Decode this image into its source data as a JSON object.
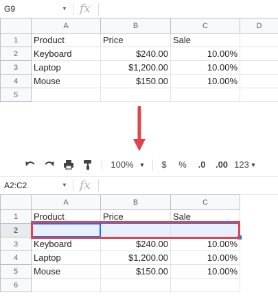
{
  "before": {
    "namebox": {
      "value": "G9"
    },
    "fx_label": "fx",
    "columns": [
      "A",
      "B",
      "C",
      "D"
    ],
    "rows": [
      {
        "num": "1",
        "cells": [
          "Product",
          "Price",
          "Sale"
        ]
      },
      {
        "num": "2",
        "cells": [
          "Keyboard",
          "$240.00",
          "10.00%"
        ]
      },
      {
        "num": "3",
        "cells": [
          "Laptop",
          "$1,200.00",
          "10.00%"
        ]
      },
      {
        "num": "4",
        "cells": [
          "Mouse",
          "$150.00",
          "10.00%"
        ]
      },
      {
        "num": "5",
        "cells": [
          "",
          "",
          ""
        ]
      }
    ]
  },
  "after": {
    "toolbar": {
      "zoom": "100%",
      "currency": "$",
      "percent": "%",
      "decrease_decimal": ".0",
      "increase_decimal": ".00",
      "more_formats": "123"
    },
    "namebox": {
      "value": "A2:C2"
    },
    "fx_label": "fx",
    "columns": [
      "A",
      "B",
      "C"
    ],
    "rows": [
      {
        "num": "1",
        "cells": [
          "Product",
          "Price",
          "Sale"
        ]
      },
      {
        "num": "2",
        "cells": [
          "",
          "",
          ""
        ],
        "selected": true
      },
      {
        "num": "3",
        "cells": [
          "Keyboard",
          "$240.00",
          "10.00%"
        ]
      },
      {
        "num": "4",
        "cells": [
          "Laptop",
          "$1,200.00",
          "10.00%"
        ]
      },
      {
        "num": "5",
        "cells": [
          "Mouse",
          "$150.00",
          "10.00%"
        ]
      },
      {
        "num": "6",
        "cells": [
          "",
          "",
          ""
        ]
      }
    ]
  },
  "colors": {
    "arrow": "#e0434e",
    "highlight_box": "#e0434e",
    "selection": "#1a73e8"
  },
  "icons": [
    "undo-icon",
    "redo-icon",
    "print-icon",
    "paint-format-icon",
    "caret-down-icon",
    "down-arrow-icon"
  ]
}
